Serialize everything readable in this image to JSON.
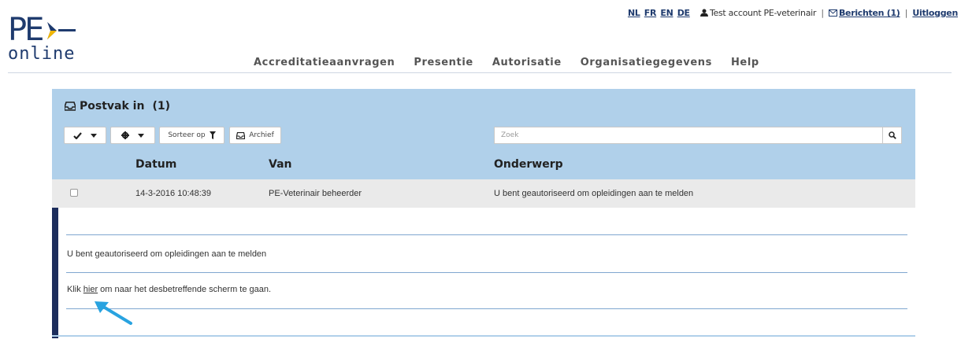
{
  "logo": {
    "text_top": "PE",
    "text_bottom": "online"
  },
  "topbar": {
    "languages": [
      "NL",
      "FR",
      "EN",
      "DE"
    ],
    "account": "Test account PE-veterinair",
    "messages": "Berichten (1)",
    "logout": "Uitloggen",
    "separator": "|"
  },
  "nav": [
    "Accreditatieaanvragen",
    "Presentie",
    "Autorisatie",
    "Organisatiegegevens",
    "Help"
  ],
  "inbox": {
    "title": "Postvak in",
    "count": "(1)",
    "sort_label": "Sorteer op",
    "archive_label": "Archief",
    "search_placeholder": "Zoek",
    "columns": {
      "date": "Datum",
      "from": "Van",
      "subject": "Onderwerp"
    },
    "message": {
      "date": "14-3-2016 10:48:39",
      "from": "PE-Veterinair beheerder",
      "subject": "U bent geautoriseerd om opleidingen aan te melden"
    },
    "detail": {
      "body": "U bent geautoriseerd om opleidingen aan te melden",
      "link_prefix": "Klik ",
      "link_text": "hier",
      "link_suffix": " om naar het desbetreffende scherm te gaan."
    }
  },
  "colors": {
    "brand": "#1f3b6e",
    "header_panel": "#b0d0ea",
    "detail_bar": "#1c2d5c",
    "pointer": "#29a3e0",
    "logo_accent": "#f2b705"
  }
}
